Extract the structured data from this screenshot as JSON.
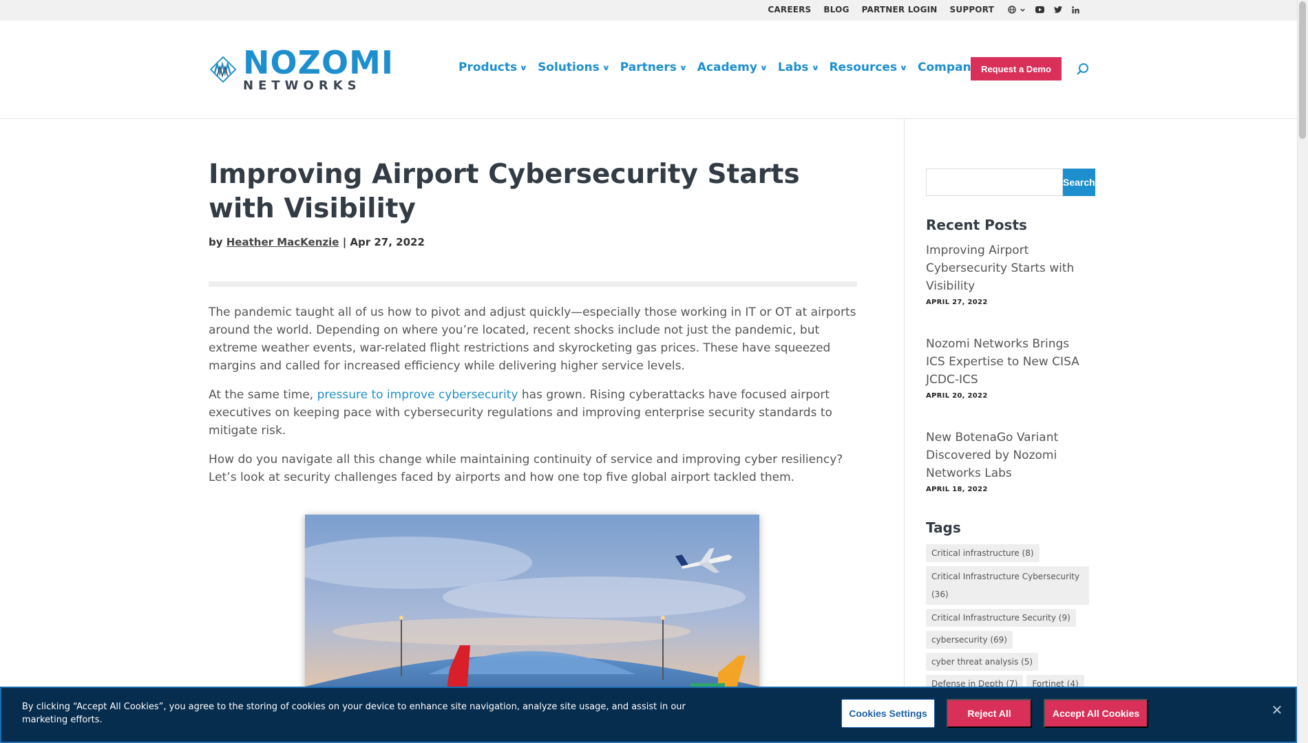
{
  "topbar": {
    "links": [
      "CAREERS",
      "BLOG",
      "PARTNER LOGIN",
      "SUPPORT"
    ],
    "icons": [
      "globe-icon",
      "youtube-icon",
      "twitter-icon",
      "linkedin-icon"
    ]
  },
  "header": {
    "logo_name": "NOZOMI",
    "logo_sub": "NETWORKS",
    "nav": [
      "Products",
      "Solutions",
      "Partners",
      "Academy",
      "Labs",
      "Resources",
      "Company"
    ],
    "demo_label": "Request a Demo"
  },
  "article": {
    "title": "Improving Airport Cybersecurity Starts with Visibility",
    "by": "by",
    "author": "Heather MacKenzie",
    "separator": "|",
    "date": "Apr 27, 2022",
    "p1": "The pandemic taught all of us how to pivot and adjust quickly—especially those working in IT or OT at airports around the world. Depending on where you’re located, recent shocks include not just the pandemic, but extreme weather events, war-related flight restrictions and skyrocketing gas prices. These have squeezed margins and called for increased efficiency while delivering higher service levels.",
    "p2_before": "At the same time, ",
    "p2_link": "pressure to improve cybersecurity",
    "p2_after": " has grown. Rising cyberattacks have focused airport executives on keeping pace with cybersecurity regulations and improving enterprise security standards to mitigate risk.",
    "p3": "How do you navigate all this change while maintaining continuity of service and improving cyber resiliency? Let’s look at security challenges faced by airports and how one top five global airport tackled them."
  },
  "sidebar": {
    "search_button": "Search",
    "search_placeholder": "",
    "recent_title": "Recent Posts",
    "posts": [
      {
        "title": "Improving Airport Cybersecurity Starts with Visibility",
        "date": "APRIL 27, 2022"
      },
      {
        "title": "Nozomi Networks Brings ICS Expertise to New CISA JCDC-ICS",
        "date": "APRIL 20, 2022"
      },
      {
        "title": "New BotenaGo Variant Discovered by Nozomi Networks Labs",
        "date": "APRIL 18, 2022"
      }
    ],
    "tags_title": "Tags",
    "tags": [
      "Critical infrastructure (8)",
      "Critical Infrastructure Cybersecurity (36)",
      "Critical Infrastructure Security (9)",
      "cybersecurity (69)",
      "cyber threat analysis (5)",
      "Defense in Depth (7)",
      "Fortinet (4)"
    ]
  },
  "cookie": {
    "text": "By clicking “Accept All Cookies”, you agree to the storing of cookies on your device to enhance site navigation, analyze site usage, and assist in our marketing efforts.",
    "settings": "Cookies Settings",
    "reject": "Reject All",
    "accept": "Accept All Cookies"
  },
  "colors": {
    "brand_blue": "#1e8fce",
    "accent_pink": "#d9305a",
    "cookie_bg": "#062c4e"
  }
}
